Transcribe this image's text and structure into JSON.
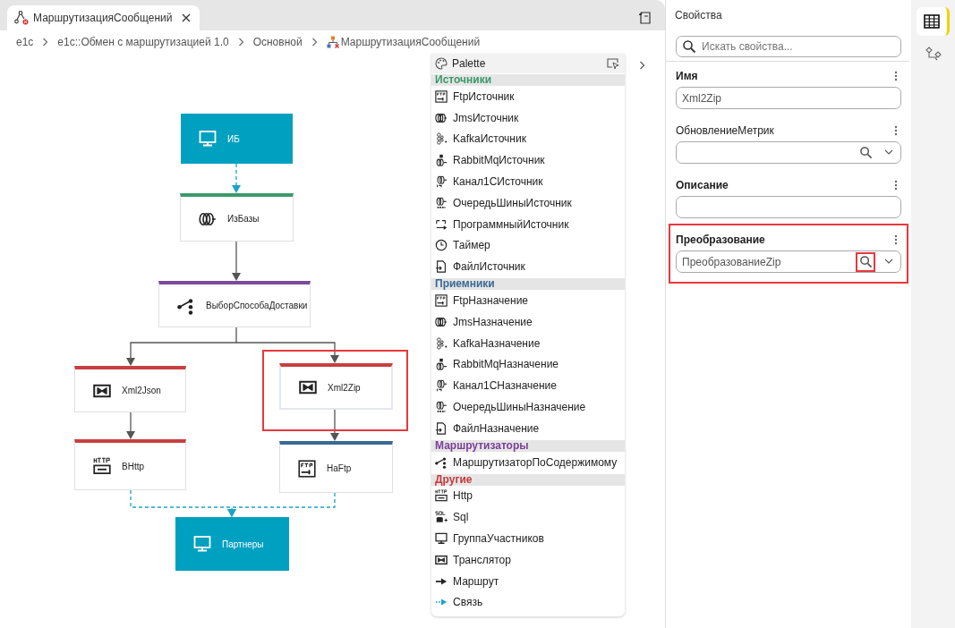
{
  "tabs": [
    {
      "label": "МаршрутизацияСообщений",
      "selected": true
    }
  ],
  "breadcrumbs": [
    "e1c",
    "e1c::Обмен с маршрутизацией 1.0",
    "Основной",
    "МаршрутизацияСообщений"
  ],
  "diagram": {
    "nodes": [
      {
        "label": "ИБ",
        "kind": "participant",
        "color": "#00a0c0",
        "highlighted": false
      },
      {
        "label": "ИзБазы",
        "kind": "channel",
        "color": "#3a9a6a",
        "highlighted": false
      },
      {
        "label": "ВыборСпособаДоставки",
        "kind": "router",
        "color": "#7b4a9a",
        "highlighted": false
      },
      {
        "label": "Xml2Json",
        "kind": "translator",
        "color": "#c6403f",
        "highlighted": false
      },
      {
        "label": "Xml2Zip",
        "kind": "translator",
        "color": "#c6403f",
        "highlighted": true
      },
      {
        "label": "ВHttp",
        "kind": "http",
        "color": "#c6403f",
        "highlighted": false
      },
      {
        "label": "НаFtp",
        "kind": "ftp",
        "color": "#3a6896",
        "highlighted": false
      },
      {
        "label": "Партнеры",
        "kind": "participant",
        "color": "#00a0c0",
        "highlighted": false
      }
    ],
    "connections": [
      {
        "kind": "link"
      },
      {
        "kind": "route"
      },
      {
        "kind": "route"
      },
      {
        "kind": "route"
      },
      {
        "kind": "route"
      },
      {
        "kind": "route"
      },
      {
        "kind": "link"
      },
      {
        "kind": "link"
      }
    ]
  },
  "palette": {
    "title": "Palette",
    "groups": [
      {
        "title": "Источники",
        "color": "#3a9a6a",
        "items": [
          {
            "label": "FtpИсточник",
            "kind": "ftp"
          },
          {
            "label": "JmsИсточник",
            "kind": "jms"
          },
          {
            "label": "KafkaИсточник",
            "kind": "kafka"
          },
          {
            "label": "RabbitMqИсточник",
            "kind": "rabbit"
          },
          {
            "label": "Канал1СИсточник",
            "kind": "channel"
          },
          {
            "label": "ОчередьШиныИсточник",
            "kind": "bus"
          },
          {
            "label": "ПрограммныйИсточник",
            "kind": "program"
          },
          {
            "label": "Таймер",
            "kind": "timer"
          },
          {
            "label": "ФайлИсточник",
            "kind": "file"
          }
        ]
      },
      {
        "title": "Приемники",
        "color": "#3a6896",
        "items": [
          {
            "label": "FtpНазначение",
            "kind": "ftp"
          },
          {
            "label": "JmsНазначение",
            "kind": "jms"
          },
          {
            "label": "KafkaНазначение",
            "kind": "kafka"
          },
          {
            "label": "RabbitMqНазначение",
            "kind": "rabbit"
          },
          {
            "label": "Канал1СНазначение",
            "kind": "channel"
          },
          {
            "label": "ОчередьШиныНазначение",
            "kind": "bus"
          },
          {
            "label": "ФайлНазначение",
            "kind": "file"
          }
        ]
      },
      {
        "title": "Маршрутизаторы",
        "color": "#7b3f9a",
        "items": [
          {
            "label": "МаршрутизаторПоСодержимому",
            "kind": "router"
          }
        ]
      },
      {
        "title": "Другие",
        "color": "#c8383b",
        "items": [
          {
            "label": "Http",
            "kind": "http"
          },
          {
            "label": "Sql",
            "kind": "sql"
          },
          {
            "label": "ГруппаУчастников",
            "kind": "group"
          },
          {
            "label": "Транслятор",
            "kind": "translator"
          },
          {
            "label": "Маршрут",
            "kind": "route"
          },
          {
            "label": "Связь",
            "kind": "link"
          }
        ]
      }
    ]
  },
  "properties": {
    "title": "Свойства",
    "search": {
      "placeholder": "Искать свойства..."
    },
    "fields": [
      {
        "label": "Имя",
        "kind": "text",
        "required": true,
        "value": "Xml2Zip",
        "highlighted": false
      },
      {
        "label": "ОбновлениеМетрик",
        "kind": "lookup",
        "required": false,
        "highlighted": false
      },
      {
        "label": "Описание",
        "kind": "text",
        "required": true,
        "highlighted": false
      },
      {
        "label": "Преобразование",
        "kind": "lookup",
        "required": true,
        "value": "ПреобразованиеZip",
        "highlighted": true
      }
    ]
  },
  "toolstrip": [
    {
      "kind": "table",
      "selected": true
    },
    {
      "kind": "diagram",
      "selected": false
    }
  ]
}
